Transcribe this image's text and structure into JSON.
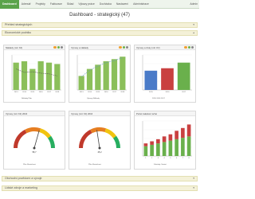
{
  "nav": {
    "items": [
      {
        "label": "Dashboard",
        "active": true
      },
      {
        "label": "Adresář",
        "active": false
      },
      {
        "label": "Projekty",
        "active": false
      },
      {
        "label": "Fakturace",
        "active": false
      },
      {
        "label": "Sklad",
        "active": false
      },
      {
        "label": "Výkazy práce",
        "active": false
      },
      {
        "label": "Docházka",
        "active": false
      },
      {
        "label": "Nastavení",
        "active": false
      },
      {
        "label": "Administrace",
        "active": false
      }
    ],
    "user": "Admin"
  },
  "page_title": "Dashboard - strategický (47)",
  "sections": {
    "top1": "Přehled strategických",
    "top2": "Ekonomické podniku",
    "bottom1": "Obchodní povědomí a vývoje",
    "bottom2": "Lidské zdroje a marketing"
  },
  "panels": {
    "p1_title": "Náklady (mil. Kč)",
    "p2_title": "Výnosy a náklady",
    "p3_title": "Výnosy a zisky (mil. Kč)",
    "p4_title": "Výnosy (mil. Kč) 2016",
    "p5_title": "Výnosy (mil. Kč) 2016",
    "p6_title": "Počet zakázek ročně",
    "p1_legend": "Náklady  Plán",
    "p2_legend": "Výnosy  Náklady",
    "p3_legend": "2015  2016  2017",
    "p4_legend": "Plán  Skutečnost",
    "p5_legend": "Plán  Skutečnost",
    "p6_legend": "Zakázky  Ostatní",
    "p4_value": "58,7",
    "p5_value": "45,2"
  },
  "chart_data": [
    {
      "type": "bar",
      "categories": [
        "2013",
        "2014",
        "2015",
        "2016",
        "2017",
        "2018"
      ],
      "series": [
        {
          "name": "Náklady",
          "values": [
            78,
            82,
            60,
            82,
            78,
            74
          ],
          "color": "#8bbf5a"
        },
        {
          "name": "Plán",
          "values": [
            60,
            50,
            52,
            48,
            46,
            40
          ],
          "color": "#555555",
          "style": "line"
        }
      ],
      "ylim": [
        0,
        100
      ]
    },
    {
      "type": "bar",
      "categories": [
        "2013",
        "2014",
        "2015",
        "2016",
        "2017",
        "2018"
      ],
      "series": [
        {
          "name": "Výnosy",
          "values": [
            40,
            60,
            72,
            82,
            88,
            95
          ],
          "color": "#8bbf5a"
        },
        {
          "name": "Náklady",
          "values": [
            38,
            56,
            68,
            78,
            84,
            92
          ],
          "color": "#6699cc",
          "style": "line"
        }
      ],
      "ylim": [
        0,
        100
      ]
    },
    {
      "type": "bar",
      "categories": [
        "2015",
        "2016",
        "2017"
      ],
      "values": [
        55,
        62,
        78
      ],
      "colors": [
        "#4a7bc8",
        "#c94040",
        "#6ab04c"
      ],
      "ylim": [
        0,
        100
      ]
    },
    {
      "type": "gauge",
      "value": 58.7,
      "min": 0,
      "max": 100
    },
    {
      "type": "gauge",
      "value": 45.2,
      "min": 0,
      "max": 100
    },
    {
      "type": "bar",
      "stacked": true,
      "categories": [
        "1",
        "2",
        "3",
        "4",
        "5",
        "6",
        "7",
        "8"
      ],
      "series": [
        {
          "name": "Zakázky",
          "values": [
            14,
            16,
            18,
            20,
            22,
            24,
            26,
            28
          ],
          "color": "#6ab04c"
        },
        {
          "name": "Ostatní",
          "values": [
            4,
            5,
            6,
            8,
            9,
            12,
            14,
            17
          ],
          "color": "#c94040"
        }
      ],
      "ylim": [
        0,
        50
      ]
    }
  ]
}
